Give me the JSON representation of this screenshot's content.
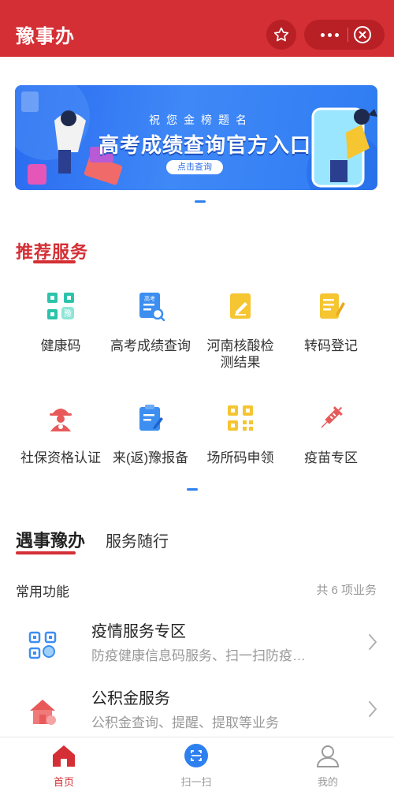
{
  "app": {
    "title": "豫事办"
  },
  "banner": {
    "subtitle": "祝您金榜题名",
    "title": "高考成绩查询官方入口",
    "button_label": "点击查询"
  },
  "recommended": {
    "title": "推荐服务",
    "items": [
      {
        "label": "健康码",
        "icon": "health-code-icon",
        "color": "#2bc3a9"
      },
      {
        "label": "高考成绩查询",
        "icon": "exam-score-icon",
        "color": "#3c8ef0"
      },
      {
        "label": "河南核酸检测结果",
        "icon": "nucleic-result-icon",
        "color": "#f5c532"
      },
      {
        "label": "转码登记",
        "icon": "transcode-register-icon",
        "color": "#f5c532"
      },
      {
        "label": "社保资格认证",
        "icon": "social-security-icon",
        "color": "#e85a5a"
      },
      {
        "label": "来(返)豫报备",
        "icon": "return-report-icon",
        "color": "#3c8ef0"
      },
      {
        "label": "场所码申领",
        "icon": "venue-code-icon",
        "color": "#f5c532"
      },
      {
        "label": "疫苗专区",
        "icon": "vaccine-icon",
        "color": "#e85a5a"
      }
    ]
  },
  "tabs": {
    "active": "遇事豫办",
    "other": "服务随行"
  },
  "common": {
    "label": "常用功能",
    "count": "共 6 项业务",
    "items": [
      {
        "title": "疫情服务专区",
        "desc": "防疫健康信息码服务、扫一扫防疫…",
        "icon": "epidemic-service-icon"
      },
      {
        "title": "公积金服务",
        "desc": "公积金查询、提醒、提取等业务",
        "icon": "housing-fund-icon"
      }
    ]
  },
  "tabbar": {
    "items": [
      {
        "label": "首页",
        "icon": "home-icon",
        "active": true
      },
      {
        "label": "扫一扫",
        "icon": "scan-icon",
        "active": false
      },
      {
        "label": "我的",
        "icon": "profile-icon",
        "active": false
      }
    ]
  },
  "colors": {
    "brand": "#d42f35",
    "accent": "#2e80ef"
  }
}
